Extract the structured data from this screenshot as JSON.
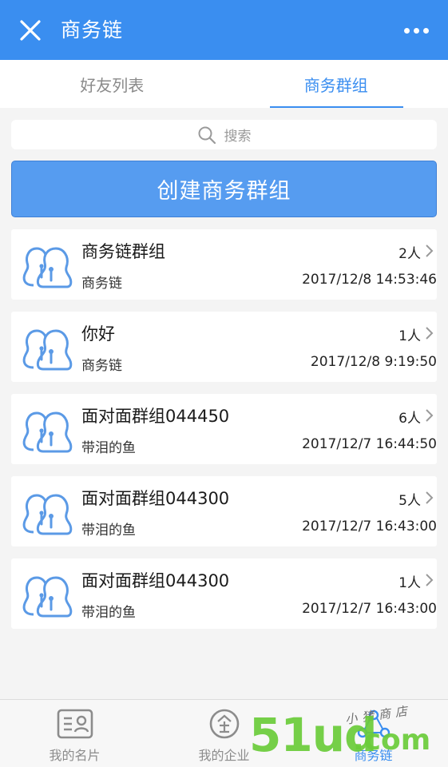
{
  "header": {
    "title": "商务链"
  },
  "tabs": [
    {
      "label": "好友列表",
      "active": false
    },
    {
      "label": "商务群组",
      "active": true
    }
  ],
  "search": {
    "placeholder": "搜索"
  },
  "create_button": {
    "label": "创建商务群组"
  },
  "groups": [
    {
      "name": "商务链群组",
      "owner": "商务链",
      "count": "2人",
      "time": "2017/12/8 14:53:46"
    },
    {
      "name": "你好",
      "owner": "商务链",
      "count": "1人",
      "time": "2017/12/8 9:19:50"
    },
    {
      "name": "面对面群组044450",
      "owner": "带泪的鱼",
      "count": "6人",
      "time": "2017/12/7 16:44:50"
    },
    {
      "name": "面对面群组044300",
      "owner": "带泪的鱼",
      "count": "5人",
      "time": "2017/12/7 16:43:00"
    },
    {
      "name": "面对面群组044300",
      "owner": "带泪的鱼",
      "count": "1人",
      "time": "2017/12/7 16:43:00"
    }
  ],
  "bottom_nav": [
    {
      "label": "我的名片",
      "icon": "business-card-icon"
    },
    {
      "label": "我的企业",
      "icon": "enterprise-icon"
    },
    {
      "label": "商务链",
      "icon": "business-chain-icon"
    }
  ],
  "watermark": {
    "brand_main": "51ud",
    "brand_suffix": ".com",
    "shop": "小猪商店"
  },
  "colors": {
    "primary": "#3a8ef0",
    "button": "#569cf0",
    "background": "#f4f4f4"
  }
}
